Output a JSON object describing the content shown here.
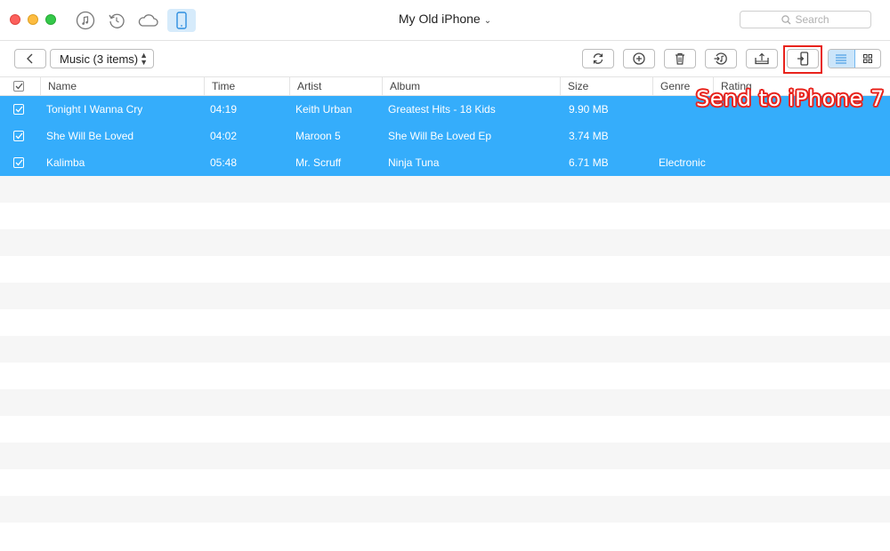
{
  "window": {
    "title": "My Old iPhone",
    "title_caret": "⌄"
  },
  "titlebar_icons": [
    "music-icon",
    "restore-icon",
    "cloud-icon",
    "device-icon"
  ],
  "search": {
    "placeholder": "Search"
  },
  "toolbar": {
    "category_label": "Music (3 items)",
    "buttons": [
      "back-icon",
      "refresh-icon",
      "add-icon",
      "trash-icon",
      "itunes-icon",
      "export-icon",
      "send-to-device-icon"
    ],
    "view_modes": [
      "list-view-icon",
      "grid-view-icon"
    ],
    "active_view": "list"
  },
  "columns": {
    "name": "Name",
    "time": "Time",
    "artist": "Artist",
    "album": "Album",
    "size": "Size",
    "genre": "Genre",
    "rating": "Rating"
  },
  "tracks": [
    {
      "name": "Tonight I Wanna Cry",
      "time": "04:19",
      "artist": "Keith Urban",
      "album": "Greatest Hits - 18 Kids",
      "size": "9.90 MB",
      "genre": "",
      "checked": true
    },
    {
      "name": "She Will Be Loved",
      "time": "04:02",
      "artist": "Maroon 5",
      "album": "She Will Be Loved Ep",
      "size": "3.74 MB",
      "genre": "",
      "checked": true
    },
    {
      "name": "Kalimba",
      "time": "05:48",
      "artist": "Mr. Scruff",
      "album": "Ninja Tuna",
      "size": "6.71 MB",
      "genre": "Electronic",
      "checked": true
    }
  ],
  "annotation": {
    "text": "Send to iPhone 7"
  },
  "colors": {
    "selection": "#35adfb",
    "highlight": "#e8231c",
    "stripe": "#f6f6f6"
  }
}
